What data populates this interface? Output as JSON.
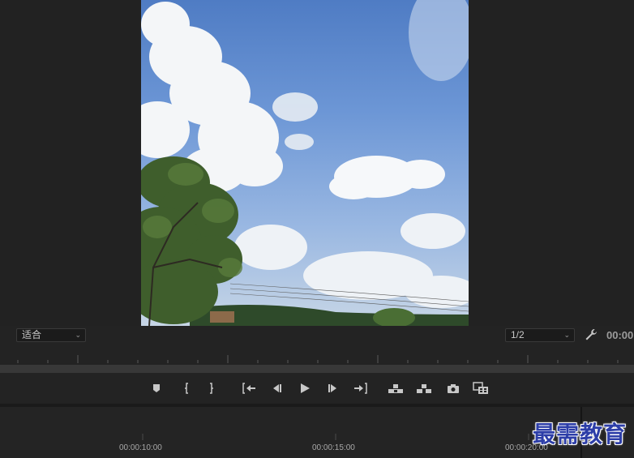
{
  "program_monitor": {
    "fit_label": "适合",
    "resolution_label": "1/2",
    "timecode": "00:00"
  },
  "transport": {
    "buttons": [
      {
        "name": "add-marker-button",
        "icon": "marker-icon"
      },
      {
        "name": "mark-in-button",
        "icon": "mark-in-icon"
      },
      {
        "name": "mark-out-button",
        "icon": "mark-out-icon"
      },
      {
        "name": "go-to-in-button",
        "icon": "go-to-in-icon"
      },
      {
        "name": "step-back-button",
        "icon": "step-back-icon"
      },
      {
        "name": "play-button",
        "icon": "play-icon"
      },
      {
        "name": "step-forward-button",
        "icon": "step-forward-icon"
      },
      {
        "name": "go-to-out-button",
        "icon": "go-to-out-icon"
      },
      {
        "name": "lift-button",
        "icon": "lift-icon"
      },
      {
        "name": "extract-button",
        "icon": "extract-icon"
      },
      {
        "name": "export-frame-button",
        "icon": "camera-icon"
      },
      {
        "name": "comparison-view-button",
        "icon": "comparison-icon"
      }
    ]
  },
  "timeline": {
    "ruler_labels": [
      "00:00:10:00",
      "00:00:15:00",
      "00:00:20:00"
    ]
  },
  "watermark": {
    "text": "最需教育"
  },
  "colors": {
    "panel_bg": "#232323",
    "icon": "#c8c8c8",
    "watermark": "#2d3ea8"
  }
}
